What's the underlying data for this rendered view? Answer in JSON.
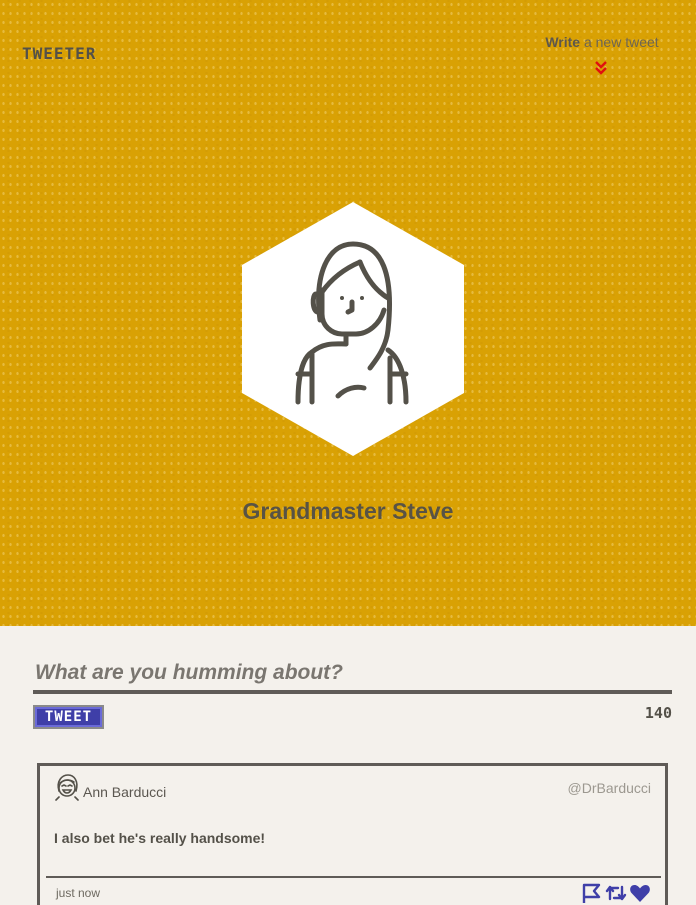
{
  "app": {
    "logo": "TWEETER"
  },
  "nav": {
    "compose_strong": "Write",
    "compose_rest": " a new tweet"
  },
  "profile": {
    "name": "Grandmaster Steve"
  },
  "compose": {
    "placeholder": "What are you humming about?",
    "button_label": "TWEET",
    "char_count": "140"
  },
  "tweets": [
    {
      "author": "Ann Barducci",
      "handle": "@DrBarducci",
      "text": "I also bet he's really handsome!",
      "time": "just now"
    }
  ],
  "colors": {
    "hero_bg": "#d9a104",
    "page_bg": "#f4f1ec",
    "text_dark": "#545149",
    "accent_blue": "#3f3fa8",
    "chevron_red": "#e01010"
  },
  "icons": {
    "compose_indicator": "double-chevron-down-icon",
    "avatar": "woman-avatar-icon",
    "tweet_avatar": "laughing-face-icon",
    "actions": [
      "flag-icon",
      "retweet-icon",
      "heart-icon"
    ]
  }
}
